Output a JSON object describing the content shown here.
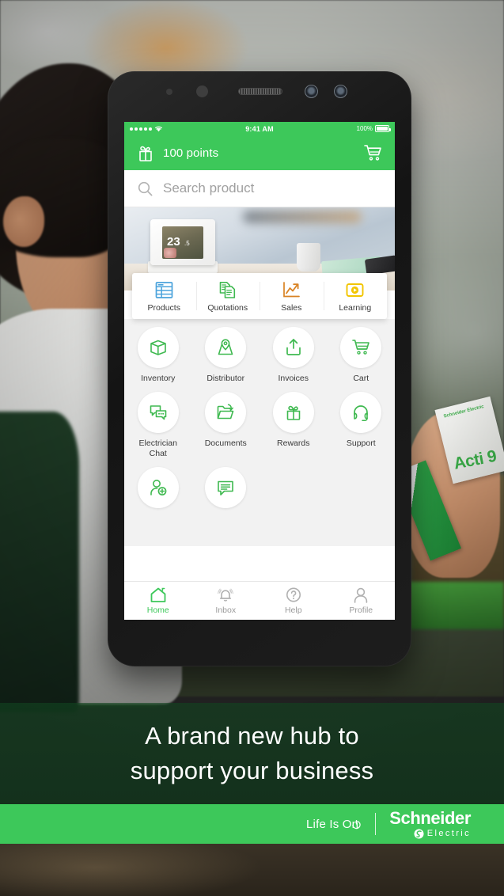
{
  "background": {
    "scene_description": "Blurred electrical supply store with a smiling man in profile on the left and a hand holding an Acti 9 product box on the right",
    "product_box_label": "Acti 9",
    "product_box_brand": "Schneider Electric"
  },
  "phone": {
    "status_bar": {
      "signal_dots": 5,
      "wifi_icon": "wifi-icon",
      "time": "9:41 AM",
      "battery_percent": "100%"
    },
    "app_bar": {
      "points_icon": "gift-icon",
      "points_label": "100 points",
      "cart_icon": "cart-icon"
    },
    "search": {
      "icon": "search-icon",
      "placeholder": "Search product"
    },
    "hero": {
      "thermostat_temp": "23",
      "thermostat_decimal": ".5"
    },
    "quick_tabs": [
      {
        "label": "Products",
        "icon": "table-grid-icon",
        "color": "#4BA3DC"
      },
      {
        "label": "Quotations",
        "icon": "documents-icon",
        "color": "#3FB950"
      },
      {
        "label": "Sales",
        "icon": "trend-up-icon",
        "color": "#D98324"
      },
      {
        "label": "Learning",
        "icon": "play-video-icon",
        "color": "#F2C500"
      }
    ],
    "grid_items": [
      {
        "label": "Inventory",
        "icon": "box-icon"
      },
      {
        "label": "Distributor",
        "icon": "map-pin-icon"
      },
      {
        "label": "Invoices",
        "icon": "upload-tray-icon"
      },
      {
        "label": "Cart",
        "icon": "cart-icon"
      },
      {
        "label": "Electrician\nChat",
        "icon": "chat-bubbles-icon"
      },
      {
        "label": "Documents",
        "icon": "folder-icon"
      },
      {
        "label": "Rewards",
        "icon": "gift-icon"
      },
      {
        "label": "Support",
        "icon": "headset-icon"
      },
      {
        "label": "",
        "icon": "add-user-icon"
      },
      {
        "label": "",
        "icon": "feedback-icon"
      }
    ],
    "bottom_nav": [
      {
        "label": "Home",
        "icon": "home-icon",
        "active": true
      },
      {
        "label": "Inbox",
        "icon": "bell-icon",
        "active": false
      },
      {
        "label": "Help",
        "icon": "question-icon",
        "active": false
      },
      {
        "label": "Profile",
        "icon": "person-icon",
        "active": false
      }
    ]
  },
  "tagline": {
    "line1": "A brand new hub to",
    "line2": "support your business"
  },
  "logo_bar": {
    "slogan": "Life Is On",
    "power_icon": "power-symbol-icon",
    "brand_name": "Schneider",
    "brand_sub": "Electric",
    "brand_mark": "se-logo-mark"
  },
  "colors": {
    "brand_green": "#3DC85A",
    "grid_background": "#F2F2F2",
    "icon_green": "#3FB950"
  }
}
